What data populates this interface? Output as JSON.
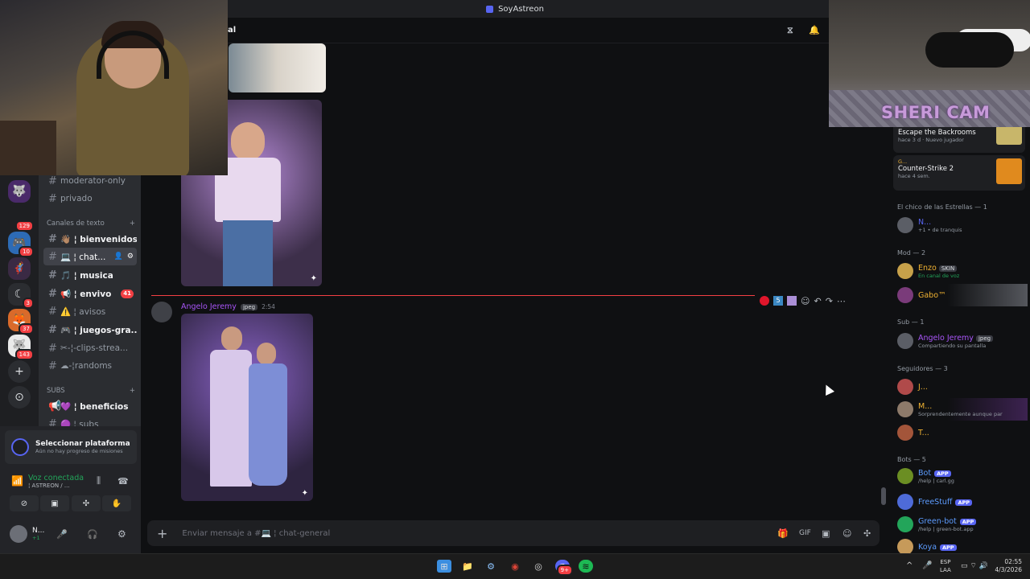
{
  "window": {
    "title": "SoyAstreon"
  },
  "stream": {
    "sheri_label": "SHERI CAM"
  },
  "header": {
    "channel_fragment": "al"
  },
  "servers": [
    {
      "badge": ""
    },
    {
      "badge": "129"
    },
    {
      "badge": "10"
    },
    {
      "badge": ""
    },
    {
      "badge": "3"
    },
    {
      "badge": "37"
    },
    {
      "badge": "143"
    }
  ],
  "channels": {
    "top": [
      {
        "label": "moderator-only"
      },
      {
        "label": "privado"
      }
    ],
    "category_text": "Canales de texto",
    "text": [
      {
        "label": "👋🏽 ¦ bienvenidos",
        "badge": ""
      },
      {
        "label": "💻 ¦ chat...",
        "badge": ""
      },
      {
        "label": "🎵 ¦ musica",
        "badge": ""
      },
      {
        "label": "📢 ¦ envivo",
        "badge": "41"
      },
      {
        "label": "⚠️ ¦ avisos",
        "badge": ""
      },
      {
        "label": "🎮 ¦ juegos-gra...",
        "badge": ""
      },
      {
        "label": "✂-¦-clips-strea...",
        "badge": ""
      },
      {
        "label": "☁-¦randoms",
        "badge": ""
      }
    ],
    "category_subs": "SUBS",
    "subs": [
      {
        "label": "💜 ¦ beneficios"
      },
      {
        "label": "🟣 ¦ subs"
      }
    ]
  },
  "panel": {
    "platform_title": "Seleccionar plataforma",
    "platform_sub": "Aún no hay progreso de misiones",
    "voice_status": "Voz conectada",
    "voice_channel": "¦ ASTREON / ...",
    "user_name": "N...",
    "user_status": "+1"
  },
  "message": {
    "author": "Angelo Jeremy",
    "tag": "jpeg",
    "time": "2:54"
  },
  "composer": {
    "placeholder": "Enviar mensaje a #💻 ¦ chat-general"
  },
  "activity": [
    {
      "game": "Escape the Backrooms",
      "meta": "hace 3 d · Nuevo jugador"
    },
    {
      "user": "G...",
      "game": "Counter-Strike 2",
      "meta": "hace 4 sem."
    }
  ],
  "members": {
    "cat_estrellas": "El chico de las Estrellas — 1",
    "estrellas": [
      {
        "name": "N...",
        "status": "+1 • de tranquis"
      }
    ],
    "cat_mod": "Mod — 2",
    "mod": [
      {
        "name": "Enzo",
        "badge": "SKIN",
        "status": "En canal de voz",
        "color": "#f0b232"
      },
      {
        "name": "Gabo™",
        "status": "",
        "color": "#f0b232"
      }
    ],
    "cat_sub": "Sub — 1",
    "sub": [
      {
        "name": "Angelo Jeremy",
        "badge": "jpeg",
        "status": "Compartiendo su pantalla",
        "color": "#a855f7"
      }
    ],
    "cat_seg": "Seguidores — 3",
    "seg": [
      {
        "name": "J...",
        "status": "",
        "color": "#f0b232"
      },
      {
        "name": "M...",
        "status": "Sorprendentemente aunque par",
        "color": "#f0b232"
      },
      {
        "name": "T...",
        "status": "",
        "color": "#f0b232"
      }
    ],
    "cat_bots": "Bots — 5",
    "bots": [
      {
        "name": "Bot",
        "status": "/help | carl.gg"
      },
      {
        "name": "FreeStuff",
        "status": ""
      },
      {
        "name": "Green-bot",
        "status": "/help | green-bot.app"
      },
      {
        "name": "Koya",
        "status": ""
      }
    ],
    "app_label": "APP"
  },
  "taskbar": {
    "lang": "ESP",
    "lang2": "LAA",
    "time": "02:55",
    "date": "4/3/2026",
    "discord_badge": "9+"
  }
}
